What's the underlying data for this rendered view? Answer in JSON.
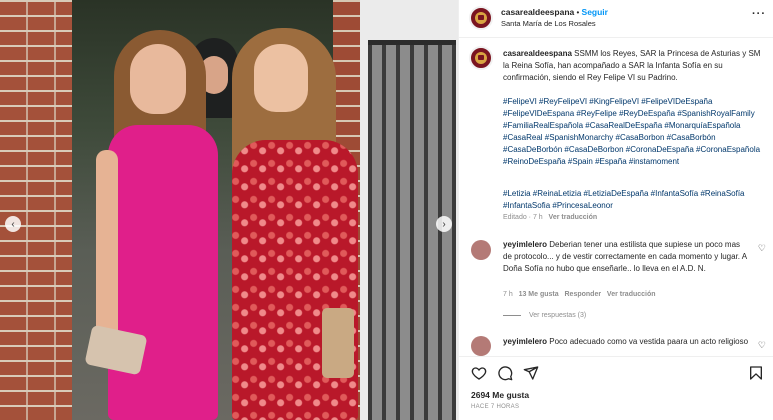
{
  "post": {
    "username": "casarealdeespana",
    "follow_label": "Seguir",
    "location": "Santa María de Los Rosales",
    "separator": "•",
    "more_label": "···"
  },
  "caption": {
    "username": "casarealdeespana",
    "text": " SSMM los Reyes, SAR la Princesa de Asturias y SM la Reina Sofía, han acompañado a SAR la Infanta Sofía en su confirmación, siendo el Rey Felipe VI su Padrino.",
    "hashtags": "#FelipeVI #ReyFelipeVI #KingFelipeVI #FelipeVIDeEspaña #FelipeVIDeEspana #ReyFelipe #ReyDeEspaña #SpanishRoyalFamily #FamiliaRealEspañola #CasaRealDeEspaña #MonarquíaEspañola #CasaReal #SpanishMonarchy #CasaBorbon #CasaBorbón #CasaDeBorbón #CasaDeBorbon #CoronaDeEspaña #CoronaEspañola #ReinoDeEspaña #Spain #España #instamoment",
    "hashtags2": "#Letizia #ReinaLetizia #LetiziaDeEspaña #InfantaSofía #ReinaSofía #InfantaSofia #PrincesaLeonor",
    "edited": "Editado · 7 h",
    "translate": "Ver traducción"
  },
  "comments": [
    {
      "username": "yeyimlelero",
      "text": " Deberian tener una estilista que supiese un poco mas de protocolo... y de vestir correctamente en cada momento y lugar. A Doña Sofía no hubo que enseñarle.. lo lleva en el A.D. N.",
      "time": "7 h",
      "likes": "13 Me gusta",
      "reply": "Responder",
      "translate": "Ver traducción",
      "view_replies": "Ver respuestas (3)"
    },
    {
      "username": "yeyimlelero",
      "text": " Poco adecuado como va vestida paara un acto religioso"
    }
  ],
  "footer": {
    "likes": "2694 Me gusta",
    "time": "HACE 7 HORAS"
  },
  "icons": {
    "heart": "heart-icon",
    "comment": "comment-icon",
    "share": "share-icon",
    "save": "bookmark-icon",
    "prev": "chevron-left-icon",
    "next": "chevron-right-icon"
  },
  "colors": {
    "follow": "#0095f6",
    "hashtag": "#00376b",
    "meta": "#8e8e8e"
  }
}
